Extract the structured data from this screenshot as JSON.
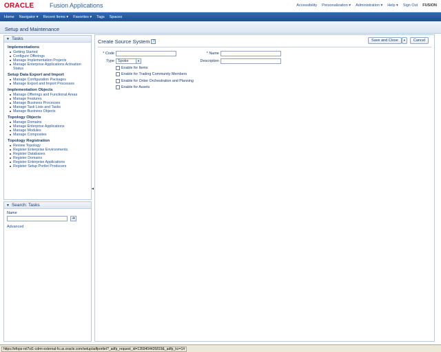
{
  "header": {
    "logo": "ORACLE",
    "app_name": "Fusion Applications",
    "global_links": [
      "Accessibility",
      "Personalization ▾",
      "Administration ▾",
      "Help ▾",
      "Sign Out"
    ],
    "user_label": "FUSION"
  },
  "nav": {
    "items": [
      "Home",
      "Navigator ▾",
      "Recent Items ▾",
      "Favorites ▾",
      "Tags",
      "Spaces"
    ]
  },
  "page": {
    "title": "Setup and Maintenance"
  },
  "tasks_panel": {
    "title": "Tasks",
    "sections": [
      {
        "title": "Implementations",
        "items": [
          "Getting Started",
          "Configure Offerings",
          "Manage Implementation Projects",
          "Manage Enterprise Applications Activation Status"
        ]
      },
      {
        "title": "Setup Data Export and Import",
        "items": [
          "Manage Configuration Packages",
          "Manage Export and Import Processes"
        ]
      },
      {
        "title": "Implementation Objects",
        "items": [
          "Manage Offerings and Functional Areas",
          "Manage Features",
          "Manage Business Processes",
          "Manage Task Lists and Tasks",
          "Manage Business Objects"
        ]
      },
      {
        "title": "Topology Objects",
        "items": [
          "Manage Domains",
          "Manage Enterprise Applications",
          "Manage Modules",
          "Manage Composites"
        ]
      },
      {
        "title": "Topology Registration",
        "items": [
          "Review Topology",
          "Register Enterprise Environments",
          "Register Databases",
          "Register Domains",
          "Register Enterprise Applications",
          "Register Setup Portlet Producers"
        ]
      }
    ]
  },
  "search_panel": {
    "title": "Search: Tasks",
    "name_label": "Name",
    "name_value": "",
    "go_icon": "arrow-right-icon",
    "advanced_label": "Advanced"
  },
  "main": {
    "title": "Create Source System",
    "save_close_label": "Save and Close",
    "cancel_label": "Cancel",
    "form": {
      "code_label": "* Code",
      "code_value": "",
      "name_label": "* Name",
      "name_value": "",
      "type_label": "Type",
      "type_value": "Spoke",
      "description_label": "Description",
      "description_value": "",
      "checkboxes": [
        "Enable for Items",
        "Enable for Trading Community Members",
        "Enable for Order Orchestration and Planning",
        "Enable for Assets"
      ]
    }
  },
  "statusbar": {
    "url": "https://efops-rel7st1-cdrm-external-fs.us.oracle.com/setup/adfportlet?_adfp_request_id=1359404426819&_adfp_tcr=1#"
  },
  "colors": {
    "oracle_red": "#d8001b",
    "nav_blue": "#1f4f90",
    "link_blue": "#1f4f8c"
  }
}
